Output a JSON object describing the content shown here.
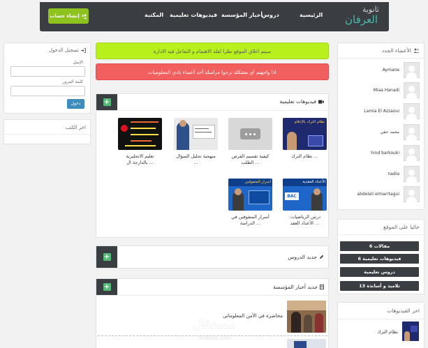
{
  "nav": {
    "brand_line1": "ثانوية",
    "brand_line2": "العرفان",
    "items": [
      "الرئيسية",
      "دروس",
      "أخبار المؤسسة",
      "فيديوهات تعليمية",
      "المكتبة"
    ],
    "signup_label": "إنشاء حساب"
  },
  "alerts": {
    "green": "سيتم اغلاق الموقع نظرا لقلة الاهتمام و التفاعل فيه الادارة",
    "red": "اذا واجهتم أي مشكلة نرجوا مراسلة أحد أعضاء نادي المعلوميات"
  },
  "videos_panel": {
    "title": "فيديوهات تعليمية",
    "items": [
      {
        "caption": "نظام الترك ..."
      },
      {
        "caption": "كيفية تقسيم الفرص الطلب ..."
      },
      {
        "caption": "منهجية تحليل السؤال ..."
      },
      {
        "caption": "تعليم الانجليزية بالدارجة ال ..."
      },
      {
        "caption": "درس الرياضيات: الأعداد العقد ..."
      },
      {
        "caption": "أسرار المتفوقين في الدراسة ..."
      }
    ],
    "thumb_texts": {
      "v1_top": "نظام الترك بالإعلام",
      "v5_top": "الأعداد العقدية",
      "v5_badge": "BAC",
      "v6_top": "أسرار المتفوقين"
    }
  },
  "lessons_panel": {
    "title": "جديد الدروس"
  },
  "news_panel": {
    "title": "جديد أخبار المؤسسة",
    "items": [
      {
        "title": "محاضرة في الأمن المعلوماتي"
      }
    ]
  },
  "login": {
    "title": "تسجيل الدخول",
    "email_label": "الإميل",
    "password_label": "كلمة المرور",
    "submit_label": "دخول"
  },
  "books": {
    "title": "اخر الكتب"
  },
  "members": {
    "title": "الأعضاء الجدد",
    "items": [
      "Aymane",
      "Miaa Hanadi",
      "Lamia El Azzaoui",
      "محمد حقي",
      "hind barkouki",
      "nadia",
      "abdelali elmarrtagui"
    ]
  },
  "stats": {
    "title": "حاليا على الموقع",
    "items": [
      "6 مقالات",
      "6 فيديوهات تعليمية",
      "دروس تعليمية",
      "13 تلاميذ و أساتذة"
    ]
  },
  "latest_videos": {
    "title": "اخر الفيديوهات",
    "items": [
      {
        "caption": "نظام الترك"
      }
    ]
  },
  "watermark": {
    "ar": "مستقل",
    "en": "mostaql.com"
  },
  "colors": {
    "nav_bg": "#3a3d42",
    "accent_green": "#8ec21f",
    "alert_green": "#b8f01e",
    "alert_red": "#f25f5f",
    "brand_teal": "#48b9a8"
  }
}
